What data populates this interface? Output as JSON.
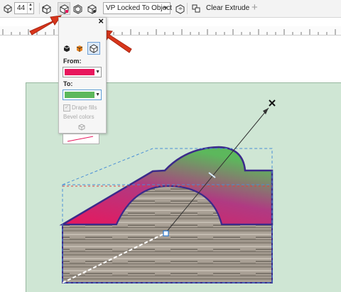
{
  "toolbar": {
    "depth_value": "44",
    "vanishing_point_select": "VP Locked To Object",
    "clear_extrude_label": "Clear Extrude",
    "add_label": "+"
  },
  "popup": {
    "close_glyph": "×",
    "from_label": "From:",
    "to_label": "To:",
    "drape_fills_label": "Drape fills",
    "bevel_colors_label": "Bevel colors",
    "from_color": "#e8175d",
    "to_color": "#5cb85c",
    "drape_fills_checked": true
  },
  "colors": {
    "page_background": "#cfe6d4",
    "arrow_annotation": "#d9361b",
    "extrude_outline": "#3b2a8a"
  }
}
